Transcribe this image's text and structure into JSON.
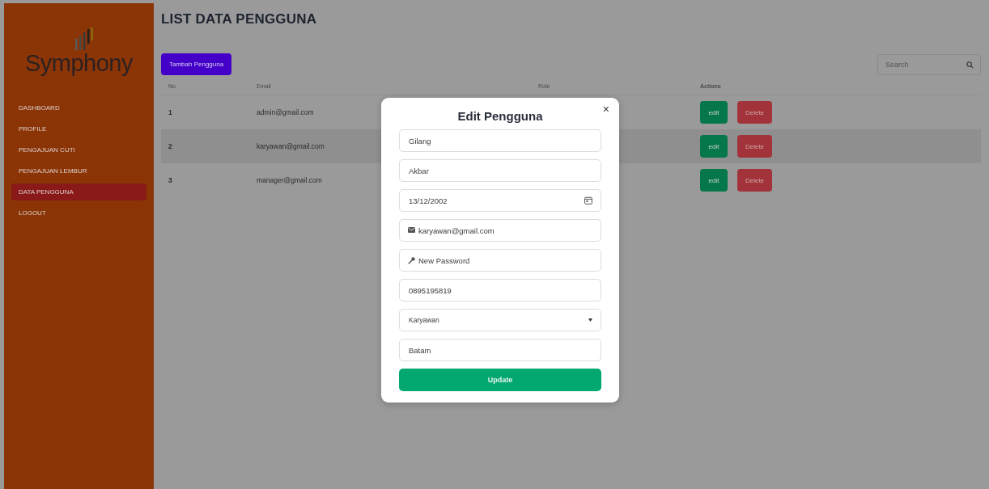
{
  "sidebar": {
    "logo": "Symphony",
    "items": [
      {
        "label": "DASHBOARD",
        "selected": false
      },
      {
        "label": "PROFILE",
        "selected": false
      },
      {
        "label": "PENGAJUAN CUTI",
        "selected": false
      },
      {
        "label": "PENGAJUAN LEMBUR",
        "selected": false
      },
      {
        "label": "DATA PENGGUNA",
        "selected": true
      },
      {
        "label": "LOGOUT",
        "selected": false
      }
    ]
  },
  "page": {
    "title": "LIST DATA PENGGUNA",
    "add_button": "Tambah Pengguna",
    "search": {
      "placeholder": "Search"
    }
  },
  "table": {
    "columns": [
      "No",
      "Email",
      "Role",
      "Actions"
    ],
    "rows": [
      {
        "no": "1",
        "email": "admin@gmail.com",
        "actions": [
          "edit",
          "Delete"
        ]
      },
      {
        "no": "2",
        "email": "karyawan@gmail.com",
        "actions": [
          "edit",
          "Delete"
        ]
      },
      {
        "no": "3",
        "email": "manager@gmail.com",
        "actions": [
          "edit",
          "Delete"
        ]
      }
    ]
  },
  "modal": {
    "title": "Edit Pengguna",
    "close": "×",
    "fields": [
      {
        "kind": "text",
        "value": "Gilang"
      },
      {
        "kind": "text",
        "value": "Akbar"
      },
      {
        "kind": "date",
        "value": "13/12/2002"
      },
      {
        "kind": "email",
        "value": "karyawan@gmail.com"
      },
      {
        "kind": "password",
        "placeholder": "New Password"
      },
      {
        "kind": "text",
        "value": "0895195819"
      },
      {
        "kind": "select",
        "value": "Karyawan"
      },
      {
        "kind": "text",
        "value": "Batam"
      }
    ],
    "submit": "Update"
  }
}
